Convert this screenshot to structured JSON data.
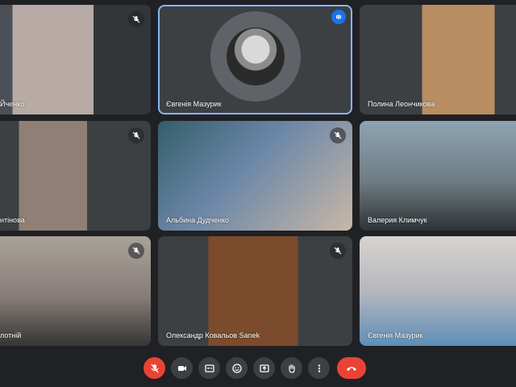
{
  "participants": [
    {
      "name": "Йченко"
    },
    {
      "name": "Євгенія Мазурик"
    },
    {
      "name": "Полина Леончикова"
    },
    {
      "name": "нтінова"
    },
    {
      "name": "Альбина Дудченко"
    },
    {
      "name": "Валерия Климчук"
    },
    {
      "name": "лотній"
    },
    {
      "name": "Олександр Ковальов Sanek"
    },
    {
      "name": "Євгенія Мазурик"
    }
  ],
  "controls": {
    "icons": [
      "mic-off-icon",
      "camera-icon",
      "captions-icon",
      "emoji-icon",
      "present-icon",
      "raise-hand-icon",
      "more-options-icon",
      "end-call-icon"
    ],
    "accent": "#ea4335",
    "speaking_color": "#1a73e8"
  }
}
